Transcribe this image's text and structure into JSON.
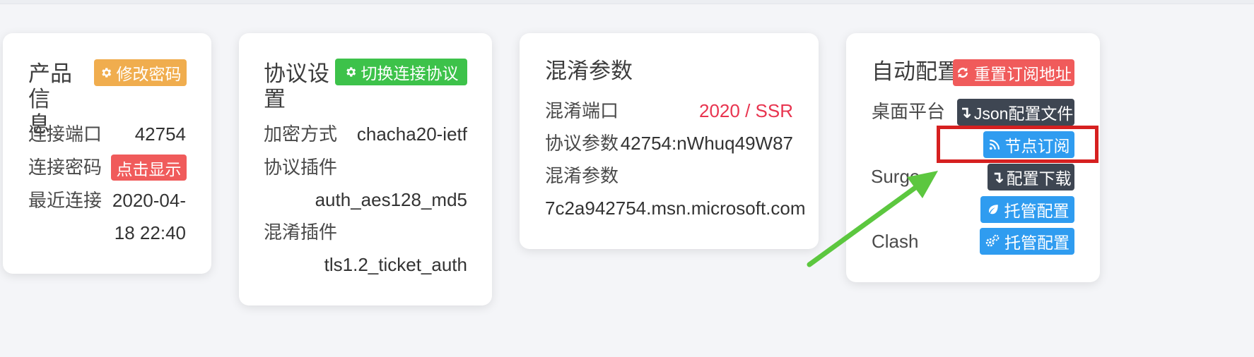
{
  "colors": {
    "accent_red": "#e8344f",
    "button_orange": "#f0ad4e",
    "button_green": "#3dc24a",
    "button_red": "#f05b5b",
    "button_dark": "#3e4652",
    "button_blue": "#2f9cf0",
    "highlight_box": "#d62020",
    "arrow": "#5cc73f"
  },
  "product": {
    "title_line1": "产品信",
    "title_line2": "息",
    "change_password_button": "修改密码",
    "port_label": "连接端口",
    "port_value": "42754",
    "password_label": "连接密码",
    "show_password_button": "点击显示",
    "last_connect_label": "最近连接",
    "last_connect_value_line1": "2020-04-",
    "last_connect_value_line2": "18 22:40"
  },
  "protocol": {
    "title_line1": "协议设",
    "title_line2": "置",
    "switch_protocol_button": "切换连接协议",
    "encryption_label": "加密方式",
    "encryption_value": "chacha20-ietf",
    "protocol_plugin_label": "协议插件",
    "protocol_plugin_value": "auth_aes128_md5",
    "obfs_plugin_label": "混淆插件",
    "obfs_plugin_value": "tls1.2_ticket_auth"
  },
  "obfs": {
    "title": "混淆参数",
    "obfs_port_label": "混淆端口",
    "obfs_port_value": "2020 / SSR",
    "protocol_param_label": "协议参数",
    "protocol_param_value": "42754:nWhuq49W87",
    "obfs_param_label": "混淆参数",
    "obfs_param_value": "7c2a942754.msn.microsoft.com"
  },
  "autoconfig": {
    "title": "自动配置",
    "reset_subscription_button": "重置订阅地址",
    "desktop_label": "桌面平台",
    "json_config_button": "Json配置文件",
    "node_subscribe_button": "节点订阅",
    "surge_label": "Surge",
    "config_download_button": "配置下载",
    "surge_managed_button": "托管配置",
    "clash_label": "Clash",
    "clash_managed_button": "托管配置"
  }
}
